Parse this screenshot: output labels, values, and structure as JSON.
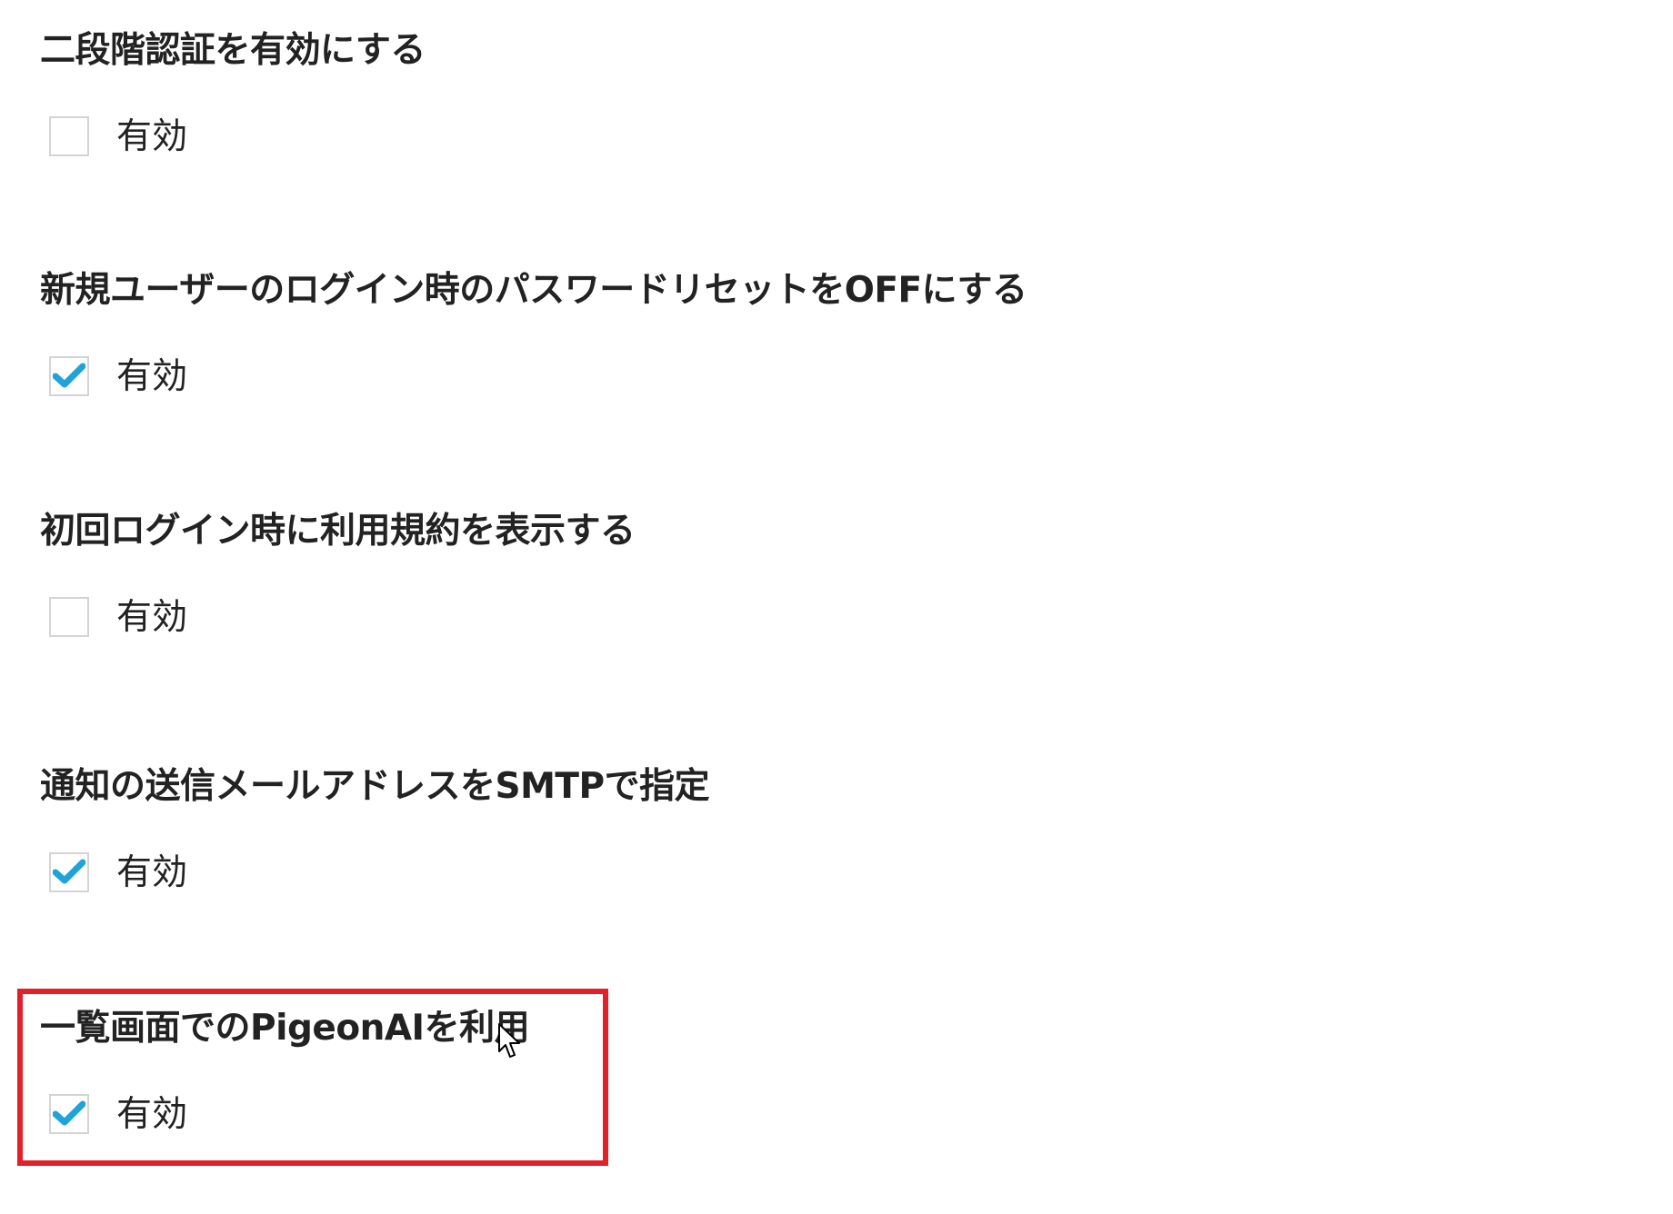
{
  "settings": [
    {
      "id": "two-factor",
      "title": "二段階認証を有効にする",
      "checkbox_label": "有効",
      "checked": false
    },
    {
      "id": "password-reset-off",
      "title": "新規ユーザーのログイン時のパスワードリセットをOFFにする",
      "checkbox_label": "有効",
      "checked": true
    },
    {
      "id": "terms-display",
      "title": "初回ログイン時に利用規約を表示する",
      "checkbox_label": "有効",
      "checked": false
    },
    {
      "id": "smtp-sender",
      "title": "通知の送信メールアドレスをSMTPで指定",
      "checkbox_label": "有効",
      "checked": true
    },
    {
      "id": "pigeon-ai",
      "title": "一覧画面でのPigeonAIを利用",
      "checkbox_label": "有効",
      "checked": true
    }
  ],
  "colors": {
    "checkmark": "#1fa3d8",
    "checkbox_border": "#d4d4d4",
    "highlight": "#e2202a",
    "text": "#222222"
  }
}
